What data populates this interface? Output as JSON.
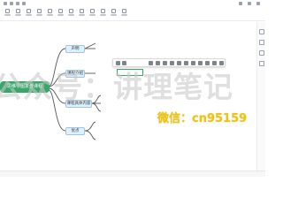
{
  "titlebar": {
    "tab_label": ""
  },
  "toolbar": {
    "tool_count": 12
  },
  "mindmap": {
    "root": {
      "label": "思维导图复盘课程"
    },
    "branches": [
      {
        "label": "声明"
      },
      {
        "label": "课程介绍"
      },
      {
        "label": "课程具体内容"
      },
      {
        "label": "优点"
      }
    ],
    "leaves": [
      {
        "label": ""
      },
      {
        "label": ""
      },
      {
        "label": ""
      },
      {
        "label": ""
      },
      {
        "label": ""
      },
      {
        "label": ""
      },
      {
        "label": ""
      },
      {
        "label": ""
      },
      {
        "label": ""
      },
      {
        "label": ""
      },
      {
        "label": ""
      },
      {
        "label": ""
      }
    ],
    "edit_box": {
      "value": ""
    }
  },
  "format_toolbar": {
    "style_label": ""
  },
  "watermarks": {
    "big": "公众号：讲理笔记",
    "wechat": "微信：cn95159"
  },
  "statusbar": {
    "zoom": ""
  },
  "colors": {
    "root": "#3aa66a",
    "branch_fill": "#dff0ff",
    "branch_border": "#9fc6ea",
    "connector": "#555555",
    "wechat_text": "#f2c500"
  }
}
